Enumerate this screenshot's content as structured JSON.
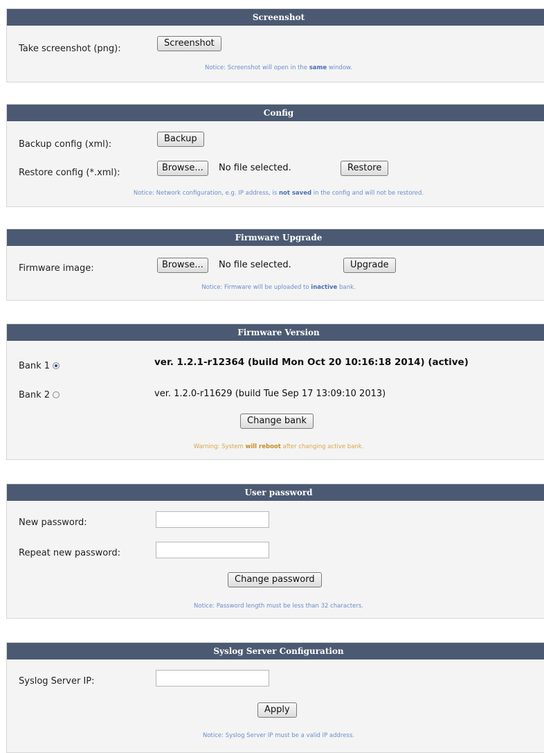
{
  "screenshot": {
    "title": "Screenshot",
    "label": "Take screenshot (png):",
    "button": "Screenshot",
    "notice_pre": "Notice: Screenshot will open in the ",
    "notice_bold": "same",
    "notice_post": " window."
  },
  "config": {
    "title": "Config",
    "backup_label": "Backup config (xml):",
    "backup_button": "Backup",
    "restore_label": "Restore config (*.xml):",
    "browse_button": "Browse...",
    "file_status": "No file selected.",
    "restore_button": "Restore",
    "notice_pre": "Notice: Network configuration, e.g. IP address, is ",
    "notice_bold": "not saved",
    "notice_post": " in the config and will not be restored."
  },
  "firmware_upgrade": {
    "title": "Firmware Upgrade",
    "label": "Firmware image:",
    "browse_button": "Browse...",
    "file_status": "No file selected.",
    "upgrade_button": "Upgrade",
    "notice_pre": "Notice: Firmware will be uploaded to ",
    "notice_bold": "inactive",
    "notice_post": " bank."
  },
  "firmware_version": {
    "title": "Firmware Version",
    "bank1_label": "Bank 1",
    "bank1_version": "ver. 1.2.1-r12364 (build Mon Oct 20 10:16:18 2014) (active)",
    "bank2_label": "Bank 2",
    "bank2_version": "ver. 1.2.0-r11629 (build Tue Sep 17 13:09:10 2013)",
    "change_button": "Change bank",
    "warn_pre": "Warning: System ",
    "warn_bold": "will reboot",
    "warn_post": " after changing active bank."
  },
  "user_password": {
    "title": "User password",
    "new_label": "New password:",
    "repeat_label": "Repeat new password:",
    "change_button": "Change password",
    "notice": "Notice: Password length must be less than 32 characters."
  },
  "syslog": {
    "title": "Syslog Server Configuration",
    "ip_label": "Syslog Server IP:",
    "apply_button": "Apply",
    "notice": "Notice: Syslog Server IP must be a valid IP address."
  }
}
